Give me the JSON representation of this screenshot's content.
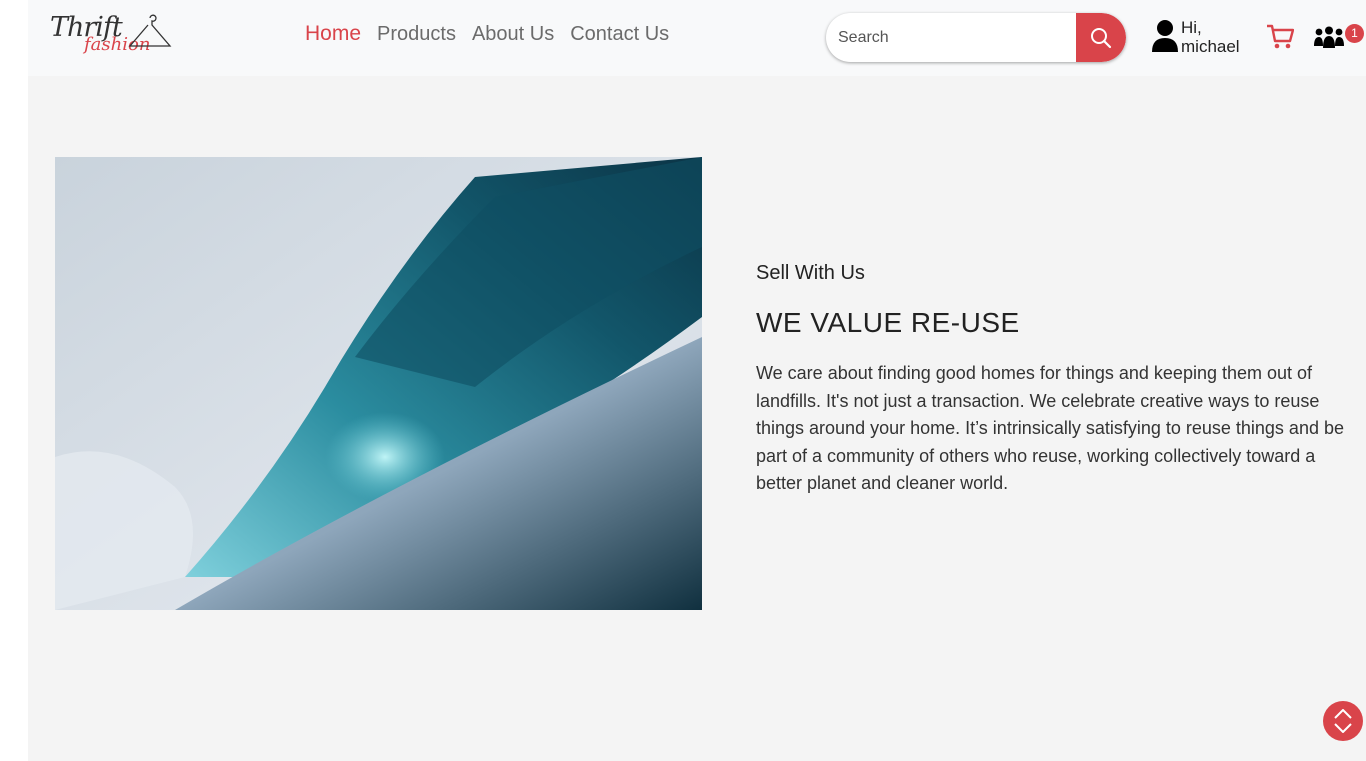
{
  "brand": {
    "logo_word1": "Thrift",
    "logo_word2": "fashion",
    "accent_color": "#d9444a"
  },
  "nav": {
    "items": [
      {
        "label": "Home",
        "active": true
      },
      {
        "label": "Products",
        "active": false
      },
      {
        "label": "About Us",
        "active": false
      },
      {
        "label": "Contact Us",
        "active": false
      }
    ]
  },
  "search": {
    "placeholder": "Search",
    "value": "",
    "icon": "search-icon"
  },
  "user": {
    "greeting": "Hi,",
    "name": "michael",
    "icon": "user-icon"
  },
  "cart": {
    "icon": "cart-icon"
  },
  "community": {
    "icon": "people-icon",
    "badge_count": "1"
  },
  "hero": {
    "image_alt": "wave-photo",
    "subtitle": "Sell With Us",
    "title": "WE VALUE RE-USE",
    "body": "We care about finding good homes for things and keeping them out of landfills. It's not just a transaction. We celebrate creative ways to reuse things around your home. It’s intrinsically satisfying to reuse things and be part of a community of others who reuse, working collectively toward a better planet and cleaner world."
  },
  "scroll_button": {
    "icon": "scroll-up-down-icon"
  }
}
